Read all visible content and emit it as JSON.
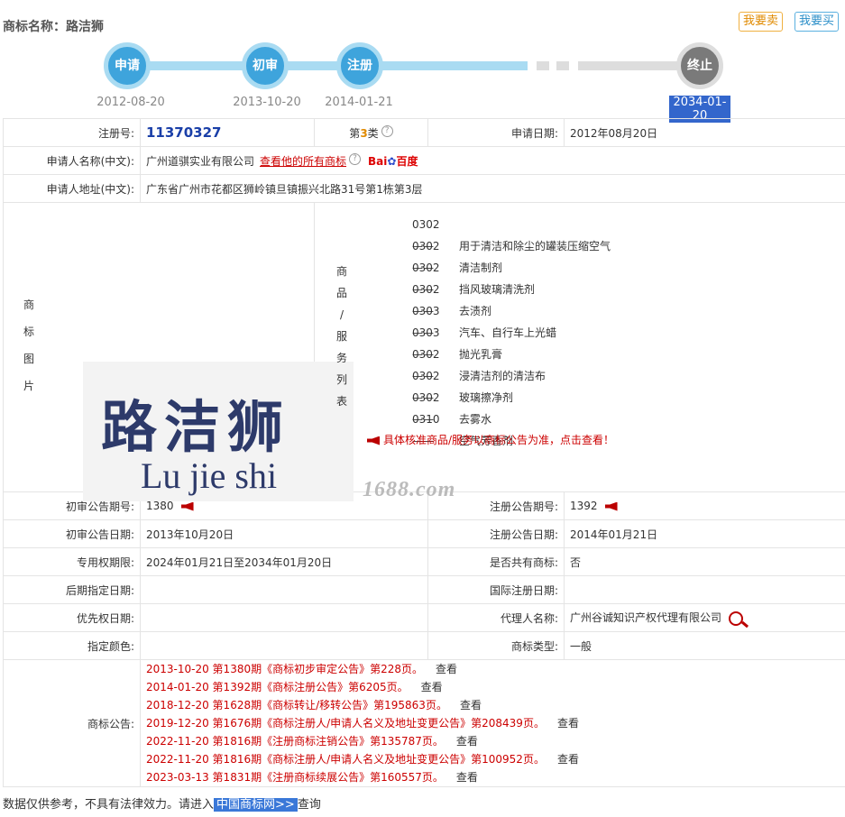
{
  "header": {
    "title": "商标名称：路洁狮",
    "sell_label": "我要卖",
    "buy_label": "我要买"
  },
  "timeline": {
    "steps": [
      {
        "label": "申请",
        "date": "2012-08-20"
      },
      {
        "label": "初审",
        "date": "2013-10-20"
      },
      {
        "label": "注册",
        "date": "2014-01-21"
      },
      {
        "label": "终止",
        "date": "2034-01-20"
      }
    ]
  },
  "info": {
    "reg_no_label": "注册号:",
    "reg_no": "11370327",
    "class_prefix": "第",
    "class_num": "3",
    "class_suffix": "类",
    "apply_date_label": "申请日期:",
    "apply_date": "2012年08月20日",
    "applicant_label": "申请人名称(中文):",
    "applicant": "广州道骐实业有限公司",
    "applicant_link": "查看他的所有商标",
    "baidu_a": "Bai",
    "baidu_b": "百度",
    "address_label": "申请人地址(中文):",
    "address": "广东省广州市花都区狮岭镇旦镇振兴北路31号第1栋第3层",
    "image_label": [
      "商",
      "标",
      "图",
      "片"
    ],
    "goods_label": [
      "商",
      "品",
      "/",
      "服",
      "务",
      "列",
      "表"
    ],
    "logo_cn": "路洁狮",
    "logo_en": "Lu jie shi",
    "watermark": "1688.com",
    "goods": [
      {
        "code": "0302——",
        "name": "用于清洁和除尘的罐装压缩空气"
      },
      {
        "code": "0302——",
        "name": "清洁制剂"
      },
      {
        "code": "0302——",
        "name": "挡风玻璃清洗剂"
      },
      {
        "code": "0302——",
        "name": "去渍剂"
      },
      {
        "code": "0303——",
        "name": "汽车、自行车上光蜡"
      },
      {
        "code": "0303——",
        "name": "抛光乳膏"
      },
      {
        "code": "0302——",
        "name": "浸清洁剂的清洁布"
      },
      {
        "code": "0302——",
        "name": "玻璃擦净剂"
      },
      {
        "code": "0302——",
        "name": "去雾水"
      },
      {
        "code": "0310——",
        "name": "空气芳香剂"
      }
    ],
    "goods_note": "具体核准商品/服务以商标公告为准，点击查看！",
    "prelim_no_label": "初审公告期号:",
    "prelim_no": "1380",
    "reg_pub_no_label": "注册公告期号:",
    "reg_pub_no": "1392",
    "prelim_date_label": "初审公告日期:",
    "prelim_date": "2013年10月20日",
    "reg_pub_date_label": "注册公告日期:",
    "reg_pub_date": "2014年01月21日",
    "exclusive_label": "专用权期限:",
    "exclusive": "2024年01月21日至2034年01月20日",
    "shared_label": "是否共有商标:",
    "shared": "否",
    "later_label": "后期指定日期:",
    "intl_label": "国际注册日期:",
    "priority_label": "优先权日期:",
    "agent_label": "代理人名称:",
    "agent": "广州谷诚知识产权代理有限公司",
    "color_label": "指定颜色:",
    "type_label": "商标类型:",
    "type": "一般",
    "ann_label": "商标公告:",
    "view_label": "查看",
    "announcements": [
      "2013-10-20 第1380期《商标初步审定公告》第228页。",
      "2014-01-20 第1392期《商标注册公告》第6205页。",
      "2018-12-20 第1628期《商标转让/移转公告》第195863页。",
      "2019-12-20 第1676期《商标注册人/申请人名义及地址变更公告》第208439页。",
      "2022-11-20 第1816期《注册商标注销公告》第135787页。",
      "2022-11-20 第1816期《商标注册人/申请人名义及地址变更公告》第100952页。",
      "2023-03-13 第1831期《注册商标续展公告》第160557页。"
    ]
  },
  "footer": {
    "text1": "数据仅供参考，不具有法律效力。请进入",
    "link": "中国商标网>>",
    "text2": "查询"
  }
}
